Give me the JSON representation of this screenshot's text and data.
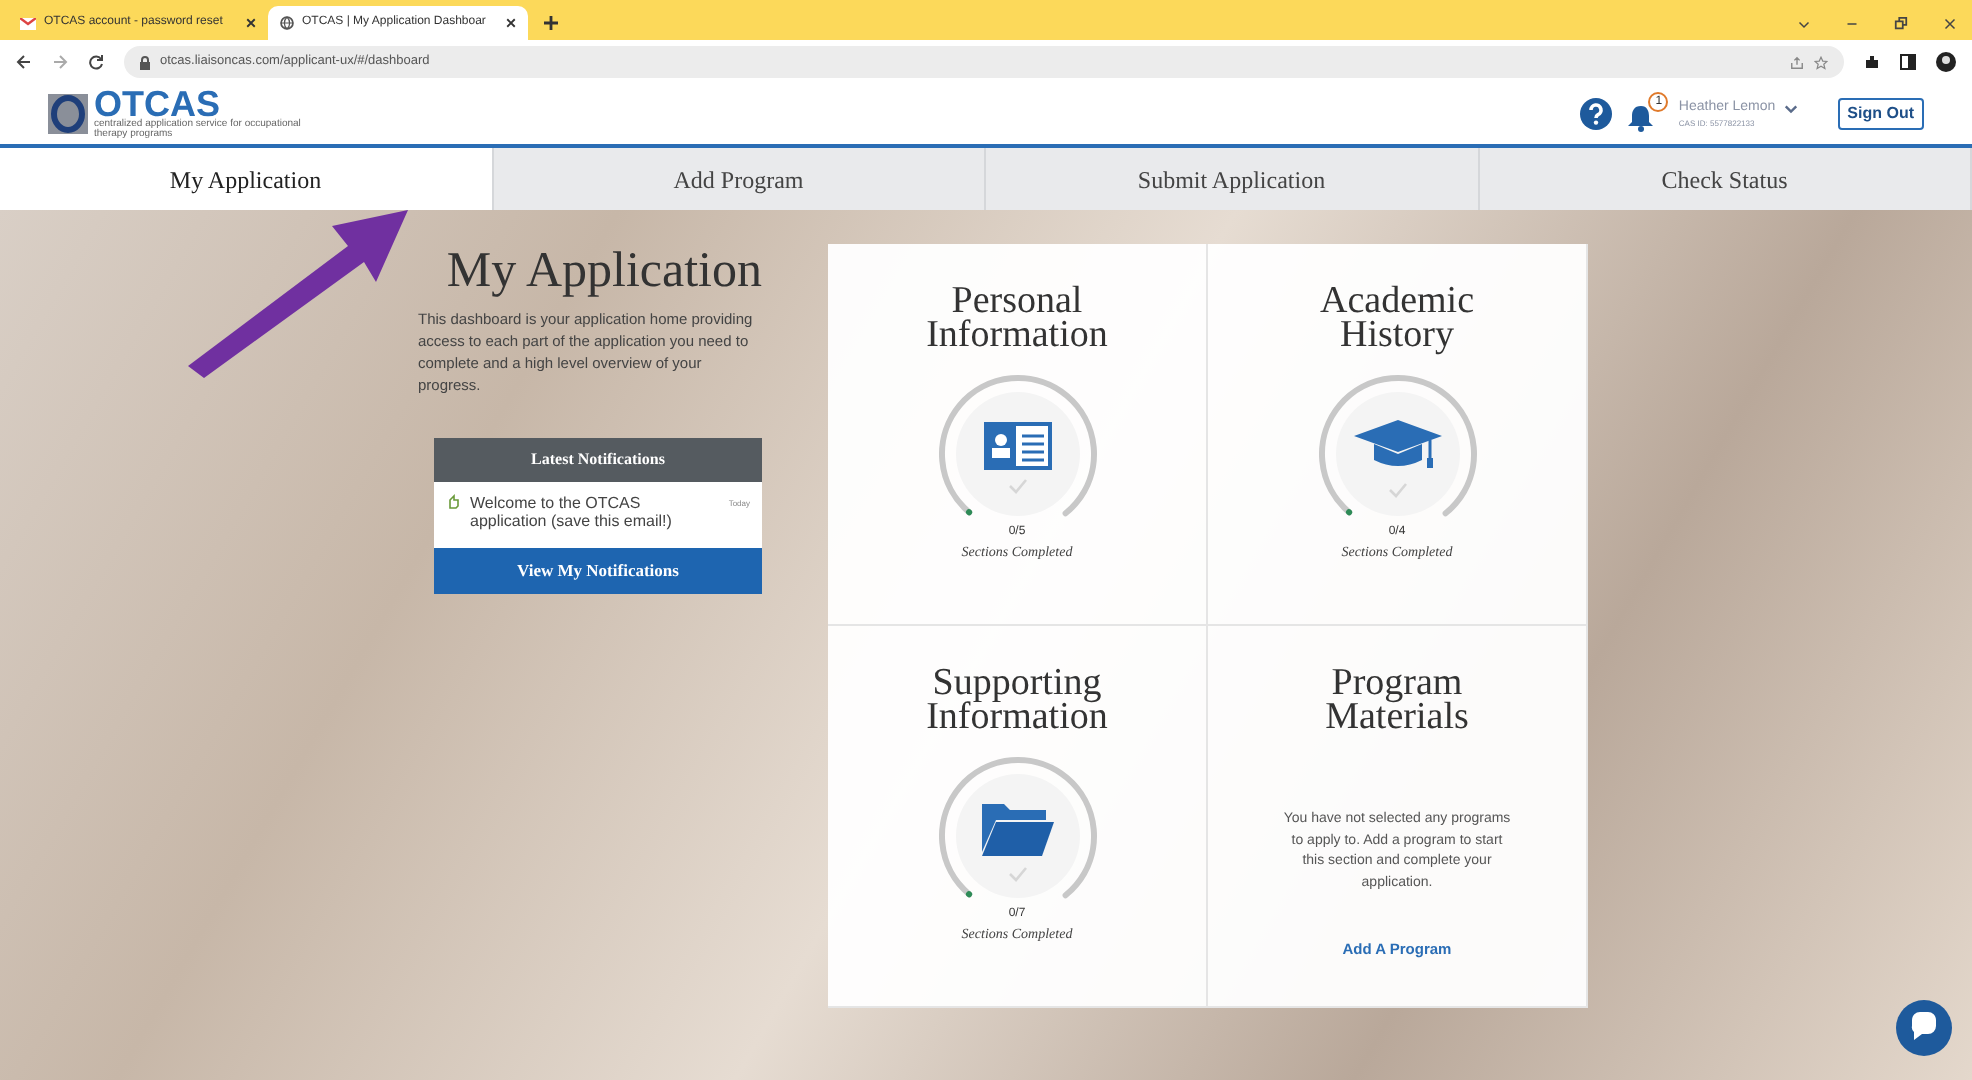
{
  "browser": {
    "tabs": [
      {
        "title": "OTCAS account - password reset",
        "selected": false,
        "kind": "mail"
      },
      {
        "title": "OTCAS | My Application Dashboar",
        "selected": true,
        "kind": "web"
      }
    ],
    "url": "otcas.liaisoncas.com/applicant-ux/#/dashboard"
  },
  "header": {
    "logo": "OTCAS",
    "logo_tagline": "centralized application service for occupational therapy programs",
    "notifications_count": "1",
    "user_name": "Heather Lemon",
    "cas_id": "CAS ID: 5577822133",
    "sign_out": "Sign Out"
  },
  "nav_tabs": [
    {
      "label": "My Application",
      "selected": true
    },
    {
      "label": "Add Program",
      "selected": false
    },
    {
      "label": "Submit Application",
      "selected": false
    },
    {
      "label": "Check Status",
      "selected": false
    }
  ],
  "intro": {
    "title": "My Application",
    "description": "This dashboard is your application home providing access to each part of the application you need to complete and a high level overview of your progress."
  },
  "notifications": {
    "title": "Latest Notifications",
    "items": [
      {
        "text": "Welcome to the OTCAS application (save this email!)",
        "time": "Today"
      }
    ],
    "button": "View My Notifications"
  },
  "cards": [
    {
      "kind": "progress",
      "title": "Personal Information",
      "count": "0/5",
      "caption": "Sections Completed"
    },
    {
      "kind": "progress",
      "title": "Academic History",
      "count": "0/4",
      "caption": "Sections Completed"
    },
    {
      "kind": "progress",
      "title": "Supporting Information",
      "count": "0/7",
      "caption": "Sections Completed"
    },
    {
      "kind": "message",
      "title": "Program Materials",
      "message": "You have not selected any programs to apply to. Add a program to start this section and complete your application.",
      "link": "Add A Program"
    }
  ]
}
